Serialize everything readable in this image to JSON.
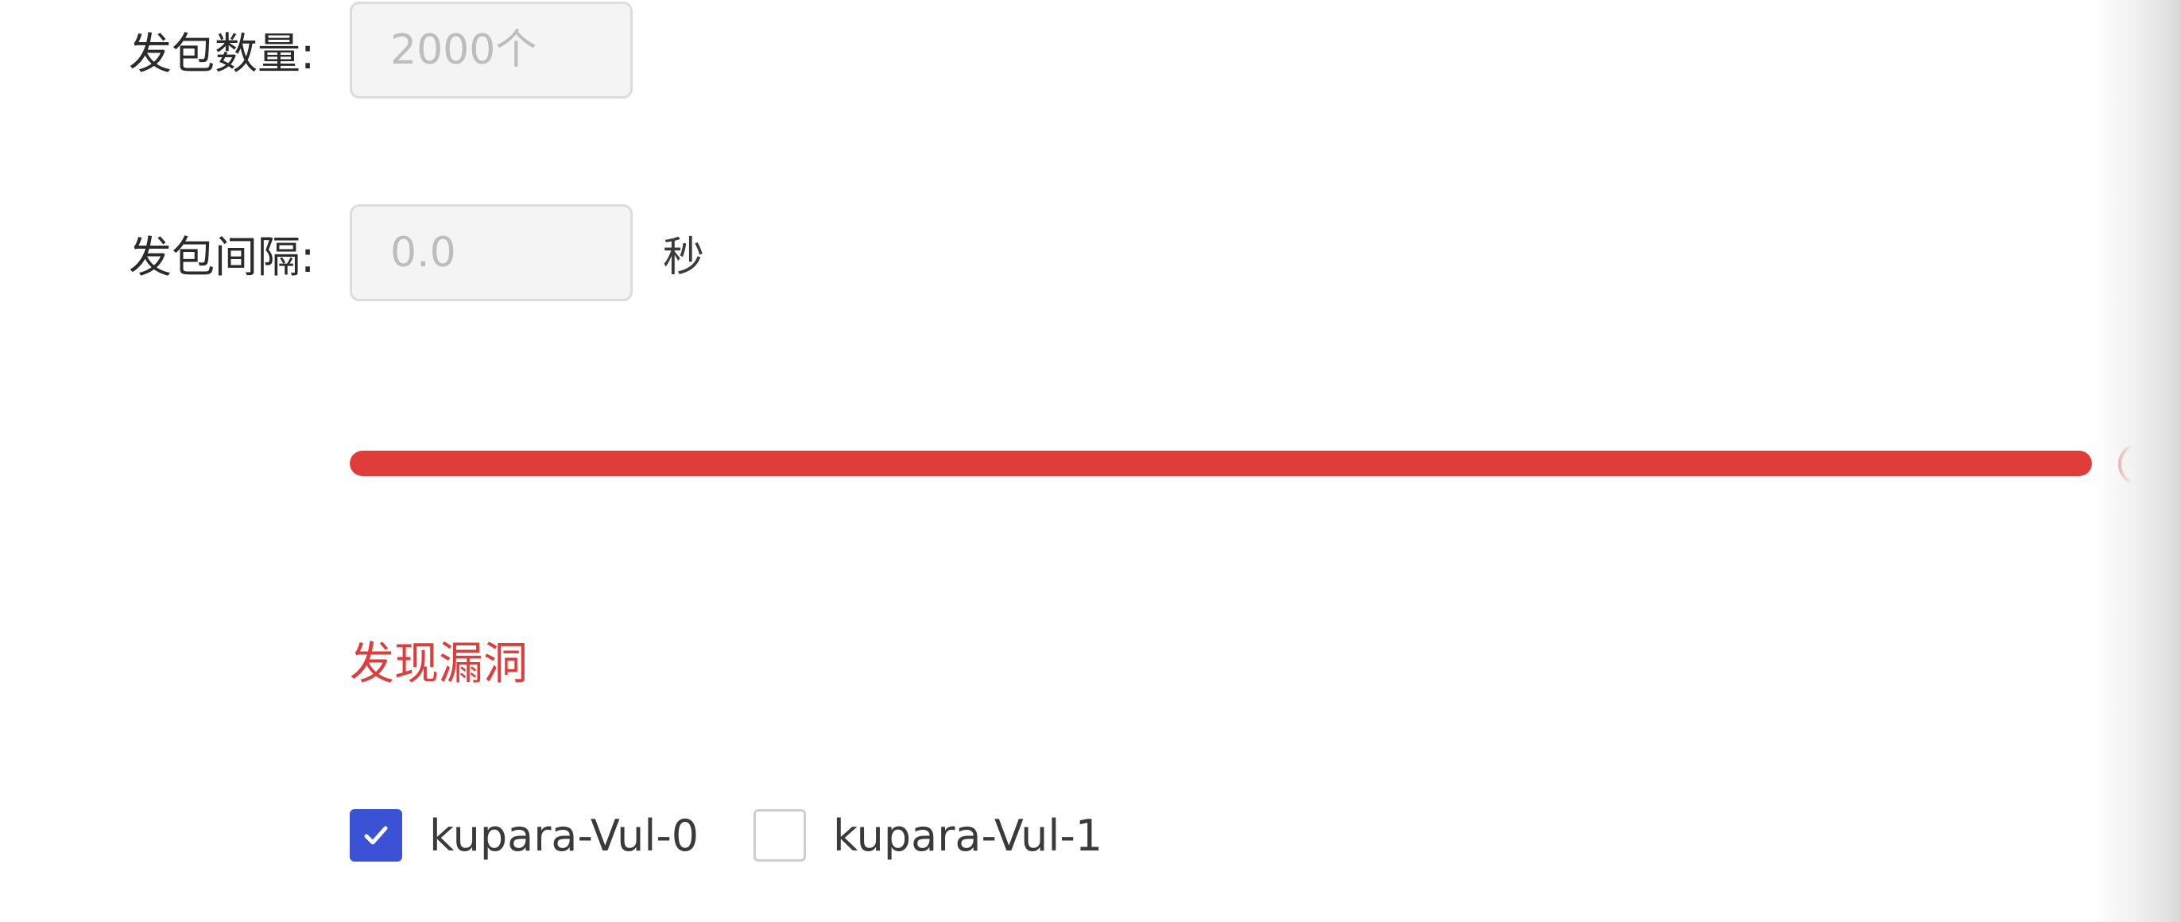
{
  "form": {
    "packet_count": {
      "label": "发包数量:",
      "placeholder": "2000个"
    },
    "packet_interval": {
      "label": "发包间隔:",
      "placeholder": "0.0",
      "unit": "秒"
    }
  },
  "progress": {
    "percent": 100,
    "status_icon": "check-circle-icon",
    "color": "#e03c3a"
  },
  "vulnerabilities": {
    "title": "发现漏洞",
    "title_color": "#e03c3a",
    "accent": "#3b52d6",
    "items": [
      {
        "label": "kupara-Vul-0",
        "checked": true
      },
      {
        "label": "kupara-Vul-1",
        "checked": false
      }
    ]
  }
}
